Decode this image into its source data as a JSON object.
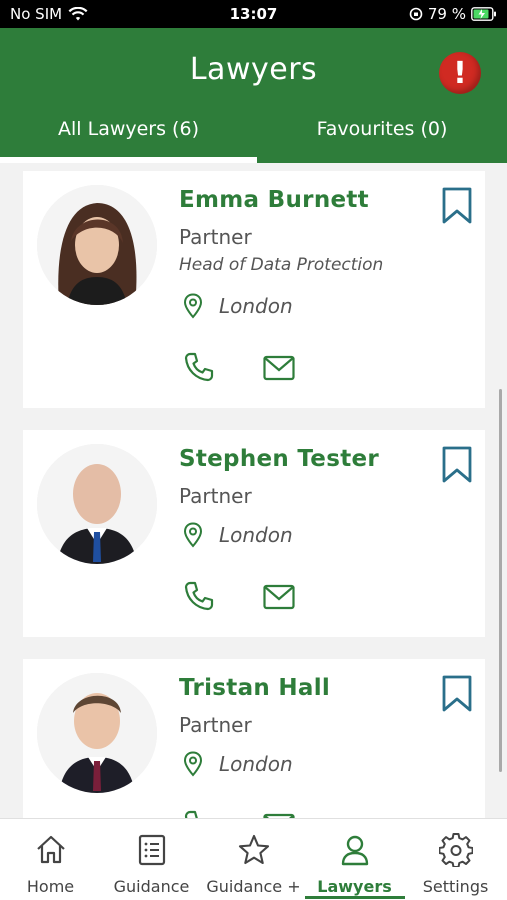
{
  "status": {
    "carrier": "No SIM",
    "time": "13:07",
    "battery": "79 %"
  },
  "header": {
    "title": "Lawyers",
    "alert_glyph": "!",
    "tabs": [
      {
        "label": "All Lawyers (6)",
        "active": true
      },
      {
        "label": "Favourites (0)",
        "active": false
      }
    ]
  },
  "lawyers": [
    {
      "name": "Emma Burnett",
      "role": "Partner",
      "subtitle": "Head of Data Protection",
      "location": "London"
    },
    {
      "name": "Stephen Tester",
      "role": "Partner",
      "location": "London"
    },
    {
      "name": "Tristan Hall",
      "role": "Partner",
      "location": "London"
    }
  ],
  "bottom_nav": [
    {
      "label": "Home",
      "icon": "home-icon"
    },
    {
      "label": "Guidance",
      "icon": "document-list-icon"
    },
    {
      "label": "Guidance +",
      "icon": "star-icon"
    },
    {
      "label": "Lawyers",
      "icon": "person-icon",
      "active": true
    },
    {
      "label": "Settings",
      "icon": "gear-icon"
    }
  ],
  "colors": {
    "brand_green": "#2e7d3a",
    "alert_red": "#d02a22",
    "bookmark_teal": "#2a6f8a"
  }
}
